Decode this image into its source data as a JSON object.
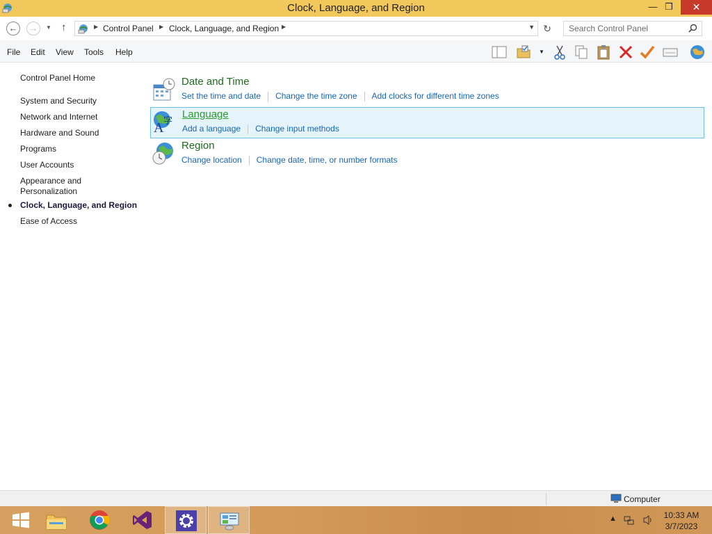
{
  "window": {
    "title": "Clock, Language, and Region",
    "min_symbol": "—",
    "max_symbol": "❐",
    "close_symbol": "✕",
    "icon": "control-panel-icon"
  },
  "address": {
    "crumbs": [
      "Control Panel",
      "Clock, Language, and Region"
    ],
    "search_placeholder": "Search Control Panel"
  },
  "menu": [
    "File",
    "Edit",
    "View",
    "Tools",
    "Help"
  ],
  "toolbar_icons": [
    "preview-pane-icon",
    "organize-folder-icon",
    "cut-icon",
    "copy-icon",
    "paste-icon",
    "delete-icon",
    "check-icon",
    "properties-icon",
    "globe-icon"
  ],
  "sidebar": {
    "home": "Control Panel Home",
    "items": [
      "System and Security",
      "Network and Internet",
      "Hardware and Sound",
      "Programs",
      "User Accounts",
      "Appearance and Personalization",
      "Clock, Language, and Region",
      "Ease of Access"
    ],
    "current": "Clock, Language, and Region"
  },
  "categories": [
    {
      "title": "Date and Time",
      "icon": "calendar-clock-icon",
      "links": [
        "Set the time and date",
        "Change the time zone",
        "Add clocks for different time zones"
      ]
    },
    {
      "title": "Language",
      "icon": "language-globe-icon",
      "links": [
        "Add a language",
        "Change input methods"
      ]
    },
    {
      "title": "Region",
      "icon": "region-globe-clock-icon",
      "links": [
        "Change location",
        "Change date, time, or number formats"
      ]
    }
  ],
  "status": {
    "label": "Computer"
  },
  "taskbar": {
    "apps": [
      "start-icon",
      "file-explorer-icon",
      "chrome-icon",
      "visual-studio-icon",
      "settings-gear-icon",
      "control-panel-icon"
    ],
    "time": "10:33 AM",
    "date": "3/7/2023"
  },
  "colors": {
    "titlebar": "#f2c75c",
    "close": "#c7392b",
    "link": "#1666b8",
    "category_title": "#1e6b1e",
    "hover_bg": "#e5f3fb",
    "hover_border": "#70c0e7"
  }
}
